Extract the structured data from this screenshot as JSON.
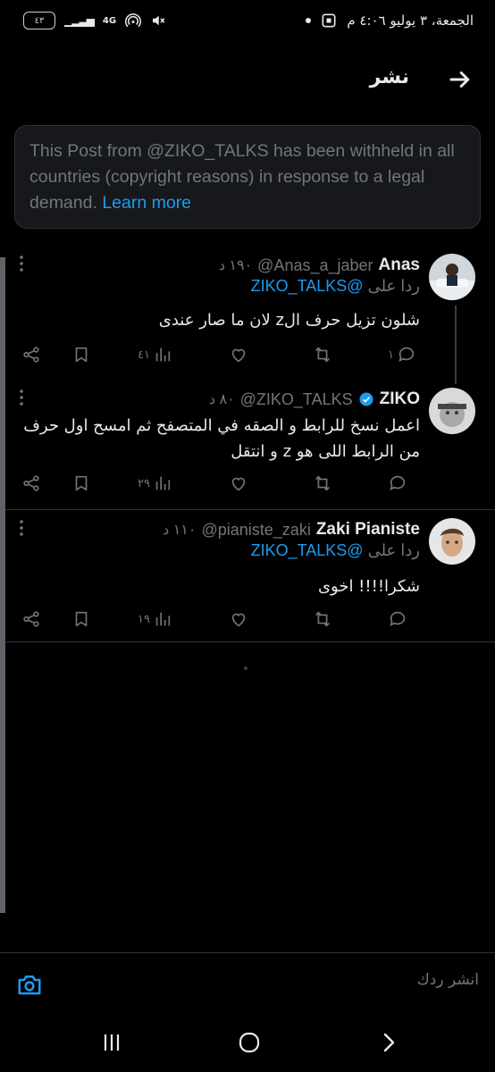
{
  "status_bar": {
    "date_time": "الجمعة، ٣ يوليو ٤:٠٦ م",
    "battery": "٤٣",
    "network": "4G"
  },
  "header": {
    "title": "نشر"
  },
  "notice": {
    "text": "This Post from @ZIKO_TALKS has been withheld in all countries (copyright reasons) in response to a legal demand.",
    "link": "Learn more"
  },
  "posts": [
    {
      "name": "Anas",
      "handle": "@Anas_a_jaber",
      "time": "١٩٠ د",
      "reply_label": "ردا على",
      "reply_mention": "@ZIKO_TALKS",
      "text": "شلون تزيل حرف الz لان ما صار عندى",
      "replies": "١",
      "views": "٤١"
    },
    {
      "name": "ZIKO",
      "handle": "@ZIKO_TALKS",
      "time": "٨٠ د",
      "verified": true,
      "text": "اعمل نسخ للرابط و الصقه في المتصفح ثم امسح اول حرف من الرابط اللى هو z و انتقل",
      "views": "٢٩"
    },
    {
      "name": "Zaki Pianiste",
      "handle": "@pianiste_zaki",
      "time": "١١٠ د",
      "reply_label": "ردا على",
      "reply_mention": "@ZIKO_TALKS",
      "text": "شكرا!!!! اخوى",
      "views": "١٩"
    }
  ],
  "reply_bar": {
    "placeholder": "انشر ردك"
  },
  "colors": {
    "accent": "#1d9bf0",
    "muted": "#71767b",
    "background": "#000000",
    "text": "#e7e9ea"
  }
}
